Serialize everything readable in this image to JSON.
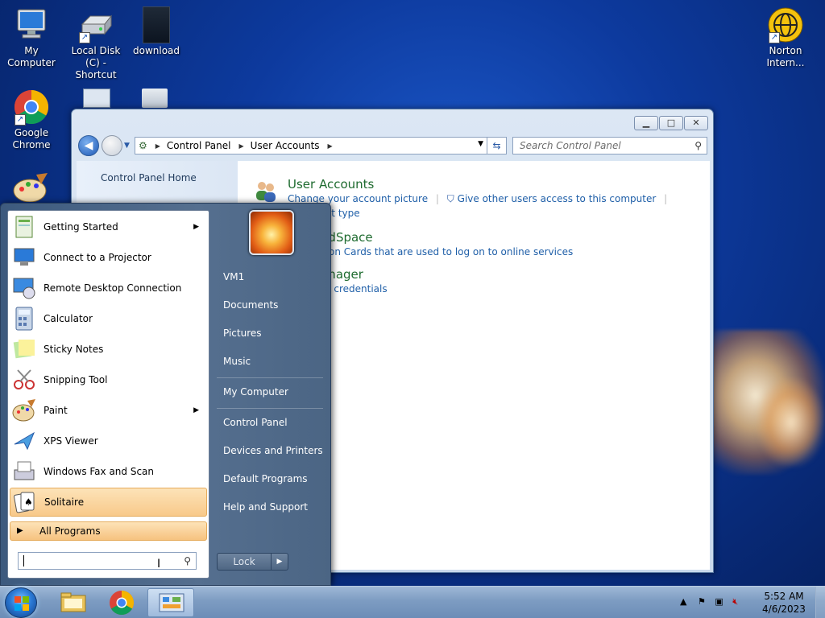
{
  "desktop": {
    "icons": [
      {
        "label": "My Computer"
      },
      {
        "label": "Local Disk (C) - Shortcut"
      },
      {
        "label": "download"
      },
      {
        "label": "Google Chrome"
      },
      {
        "label": "Norton Intern..."
      }
    ]
  },
  "window": {
    "address": {
      "crumb1": "Control Panel",
      "crumb2": "User Accounts"
    },
    "search_placeholder": "Search Control Panel",
    "left_pane": {
      "home_link": "Control Panel Home"
    },
    "sections": {
      "user_accounts": {
        "title": "User Accounts",
        "link_change_picture": "Change your account picture",
        "link_give_access": "Give other users access to this computer",
        "link_account_type": "e account type"
      },
      "cardspace": {
        "title": "ws CardSpace",
        "link_manage_cards": "nformation Cards that are used to log on to online services"
      },
      "credential": {
        "title": "tial Manager",
        "link_manage_creds": "Windows credentials"
      }
    }
  },
  "start_menu": {
    "programs": [
      {
        "label": "Getting Started",
        "has_submenu": true
      },
      {
        "label": "Connect to a Projector"
      },
      {
        "label": "Remote Desktop Connection"
      },
      {
        "label": "Calculator"
      },
      {
        "label": "Sticky Notes"
      },
      {
        "label": "Snipping Tool"
      },
      {
        "label": "Paint",
        "has_submenu": true
      },
      {
        "label": "XPS Viewer"
      },
      {
        "label": "Windows Fax and Scan"
      },
      {
        "label": "Solitaire",
        "highlighted": true
      }
    ],
    "all_programs_label": "All Programs",
    "search_value": "",
    "right_items": {
      "user": "VM1",
      "documents": "Documents",
      "pictures": "Pictures",
      "music": "Music",
      "my_computer": "My Computer",
      "control_panel": "Control Panel",
      "devices": "Devices and Printers",
      "default_programs": "Default Programs",
      "help": "Help and Support"
    },
    "lock_label": "Lock"
  },
  "taskbar": {
    "time": "5:52 AM",
    "date": "4/6/2023"
  }
}
